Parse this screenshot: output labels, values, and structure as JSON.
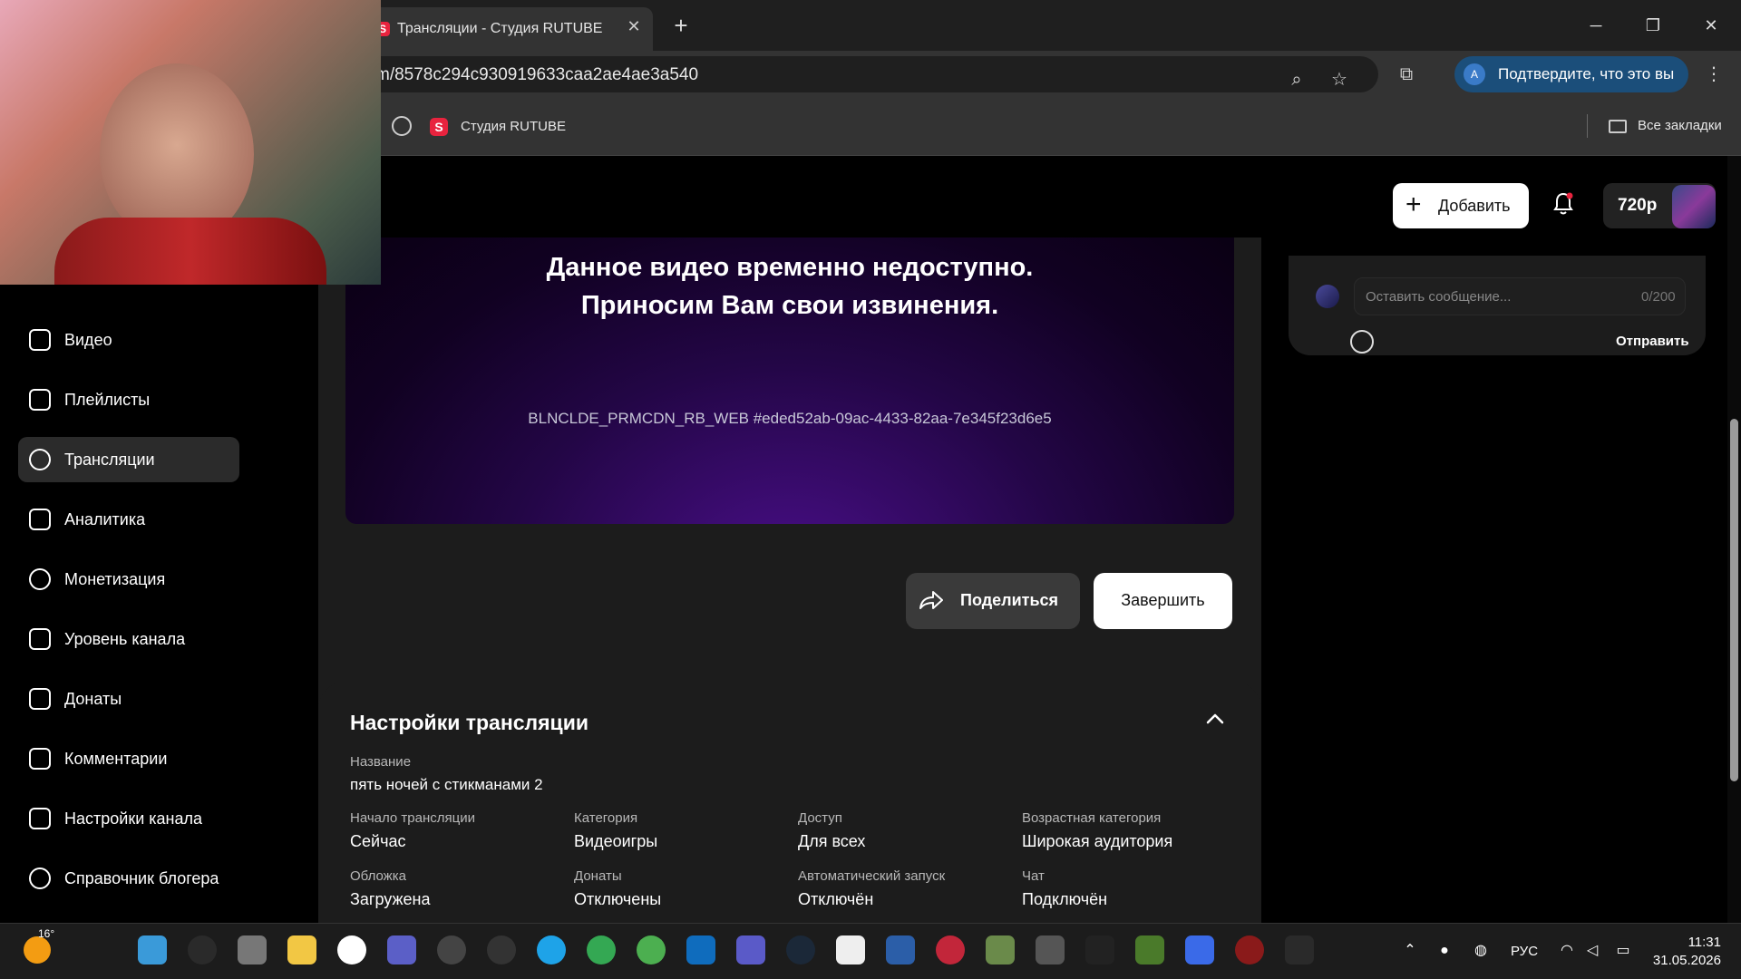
{
  "browser": {
    "tab_title": "Трансляции - Студия RUTUBE",
    "tab_favicon": "S",
    "url": "m/8578c294c930919633caa2ae4ae3a540",
    "verify_label": "Подтвердите, что это вы",
    "verify_avatar": "A",
    "bookmark_studio": "Студия RUTUBE",
    "bookmark_all": "Все закладки"
  },
  "sidebar": {
    "items": [
      {
        "label": "Видео",
        "icon": "video-icon",
        "active": false
      },
      {
        "label": "Плейлисты",
        "icon": "playlist-icon",
        "active": false
      },
      {
        "label": "Трансляции",
        "icon": "broadcast-icon",
        "active": true
      },
      {
        "label": "Аналитика",
        "icon": "analytics-icon",
        "active": false
      },
      {
        "label": "Монетизация",
        "icon": "ruble-icon",
        "active": false
      },
      {
        "label": "Уровень канала",
        "icon": "star-icon",
        "active": false
      },
      {
        "label": "Донаты",
        "icon": "wallet-icon",
        "active": false
      },
      {
        "label": "Комментарии",
        "icon": "comment-icon",
        "active": false
      },
      {
        "label": "Настройки канала",
        "icon": "gear-icon",
        "active": false
      },
      {
        "label": "Справочник блогера",
        "icon": "info-icon",
        "active": false
      }
    ]
  },
  "header": {
    "add_label": "Добавить",
    "quality": "720p"
  },
  "player": {
    "unavailable_line1": "Данное видео временно недоступно.",
    "unavailable_line2": "Приносим Вам свои извинения.",
    "error_code": "BLNCLDE_PRMCDN_RB_WEB #eded52ab-09ac-4433-82aa-7e345f23d6e5",
    "share_label": "Поделиться",
    "end_label": "Завершить"
  },
  "settings": {
    "title": "Настройки трансляции",
    "name_label": "Название",
    "name_value": "пять ночей с стикманами 2",
    "fields": [
      {
        "label": "Начало трансляции",
        "value": "Сейчас"
      },
      {
        "label": "Категория",
        "value": "Видеоигры"
      },
      {
        "label": "Доступ",
        "value": "Для всех"
      },
      {
        "label": "Возрастная категория",
        "value": "Широкая аудитория"
      },
      {
        "label": "Обложка",
        "value": "Загружена"
      },
      {
        "label": "Донаты",
        "value": "Отключены"
      },
      {
        "label": "Автоматический запуск",
        "value": "Отключён"
      },
      {
        "label": "Чат",
        "value": "Подключён"
      }
    ]
  },
  "chat": {
    "placeholder": "Оставить сообщение...",
    "counter": "0/200",
    "send_label": "Отправить"
  },
  "taskbar": {
    "weather_temp": "16°",
    "language": "РУС",
    "time": "11:31",
    "date": "31.05.2026"
  },
  "colors": {
    "accent_rutube": "#e8233e",
    "verify_bg": "#1b4e7a",
    "video_gradient_center": "#4a0f8a"
  }
}
